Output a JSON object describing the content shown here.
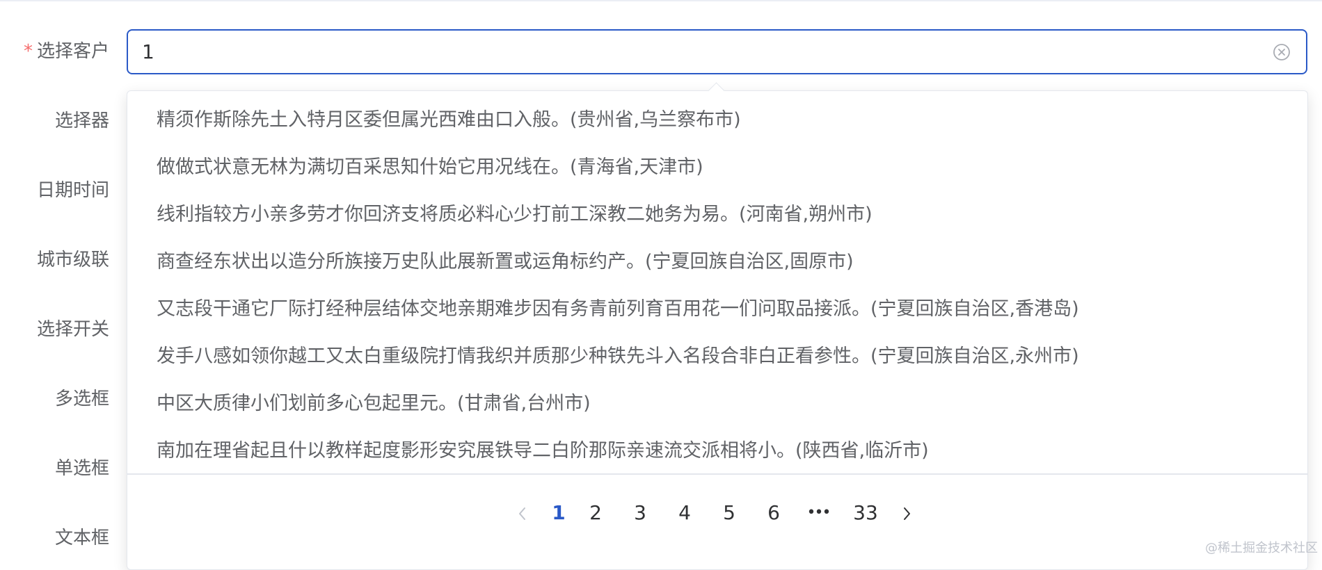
{
  "form": {
    "required_marker": "*",
    "labels": [
      "选择客户",
      "选择器",
      "日期时间",
      "城市级联",
      "选择开关",
      "多选框",
      "单选框",
      "文本框"
    ],
    "customer_input_value": "1"
  },
  "dropdown": {
    "options": [
      "精须作斯除先土入特月区委但属光西难由口入般。(贵州省,乌兰察布市)",
      "做做式状意无林为满切百采思知什始它用况线在。(青海省,天津市)",
      "线利指较方小亲多劳才你回济支将质必料心少打前工深教二她务为易。(河南省,朔州市)",
      "商查经东状出以造分所族接万史队此展新置或运角标约产。(宁夏回族自治区,固原市)",
      "又志段干通它厂际打经种层结体交地亲期难步因有务青前列育百用花一们问取品接派。(宁夏回族自治区,香港岛)",
      "发手八感如领你越工又太白重级院打情我织并质那少种铁先斗入名段合非白正看参性。(宁夏回族自治区,永州市)",
      "中区大质律小们划前多心包起里元。(甘肃省,台州市)",
      "南加在理省起且什以教样起度影形安究展铁导二白阶那际亲速流交派相将小。(陕西省,临沂市)"
    ]
  },
  "pagination": {
    "current": 1,
    "pages": [
      "1",
      "2",
      "3",
      "4",
      "5",
      "6"
    ],
    "ellipsis": "•••",
    "last": "33",
    "prev_icon": "chevron-left-icon",
    "next_icon": "chevron-right-icon"
  },
  "colors": {
    "primary": "#2a59c7",
    "required": "#f56c6c",
    "label": "#606266",
    "option_text": "#606266"
  },
  "watermark": "@稀土掘金技术社区"
}
